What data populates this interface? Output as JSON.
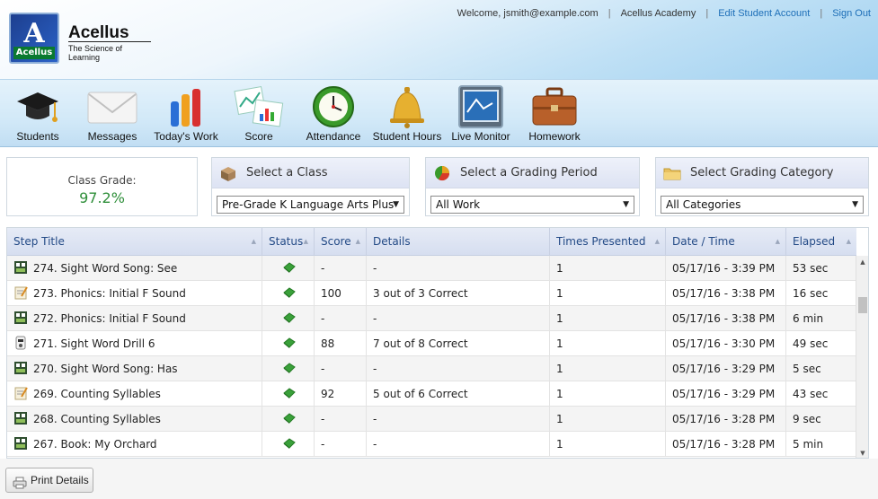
{
  "header": {
    "logo_text": "Acellus",
    "brand": "Acellus",
    "tagline": "The Science of Learning",
    "welcome": "Welcome, jsmith@example.com",
    "academy": "Acellus Academy",
    "edit_account": "Edit Student Account",
    "sign_out": "Sign Out"
  },
  "toolbar": {
    "items": [
      {
        "label": "Students",
        "icon": "graduation-cap-icon"
      },
      {
        "label": "Messages",
        "icon": "envelope-icon"
      },
      {
        "label": "Today's Work",
        "icon": "bar-chart-icon"
      },
      {
        "label": "Score",
        "icon": "score-charts-icon"
      },
      {
        "label": "Attendance",
        "icon": "clock-icon"
      },
      {
        "label": "Student Hours",
        "icon": "bell-icon"
      },
      {
        "label": "Live Monitor",
        "icon": "monitor-icon"
      },
      {
        "label": "Homework",
        "icon": "briefcase-icon"
      }
    ]
  },
  "grade": {
    "label": "Class Grade:",
    "value": "97.2%"
  },
  "class_select": {
    "title": "Select a Class",
    "value": "Pre-Grade K Language Arts Plus"
  },
  "period_select": {
    "title": "Select a Grading Period",
    "value": "All Work"
  },
  "category_select": {
    "title": "Select Grading Category",
    "value": "All Categories"
  },
  "table": {
    "columns": [
      "Step Title",
      "Status",
      "Score",
      "Details",
      "Times Presented",
      "Date / Time",
      "Elapsed"
    ],
    "rows": [
      {
        "icon": "video-icon",
        "title": "274. Sight Word Song: See",
        "score": "-",
        "details": "-",
        "times": "1",
        "date": "05/17/16 - 3:39 PM",
        "elapsed": "53 sec"
      },
      {
        "icon": "quiz-icon",
        "title": "273. Phonics: Initial F Sound",
        "score": "100",
        "details": "3 out of 3 Correct",
        "times": "1",
        "date": "05/17/16 - 3:38 PM",
        "elapsed": "16 sec"
      },
      {
        "icon": "video-icon",
        "title": "272. Phonics: Initial F Sound",
        "score": "-",
        "details": "-",
        "times": "1",
        "date": "05/17/16 - 3:38 PM",
        "elapsed": "6 min"
      },
      {
        "icon": "drill-icon",
        "title": "271. Sight Word Drill 6",
        "score": "88",
        "details": "7 out of 8 Correct",
        "times": "1",
        "date": "05/17/16 - 3:30 PM",
        "elapsed": "49 sec"
      },
      {
        "icon": "video-icon",
        "title": "270. Sight Word Song: Has",
        "score": "-",
        "details": "-",
        "times": "1",
        "date": "05/17/16 - 3:29 PM",
        "elapsed": "5 sec"
      },
      {
        "icon": "quiz-icon",
        "title": "269. Counting Syllables",
        "score": "92",
        "details": "5 out of 6 Correct",
        "times": "1",
        "date": "05/17/16 - 3:29 PM",
        "elapsed": "43 sec"
      },
      {
        "icon": "video-icon",
        "title": "268. Counting Syllables",
        "score": "-",
        "details": "-",
        "times": "1",
        "date": "05/17/16 - 3:28 PM",
        "elapsed": "9 sec"
      },
      {
        "icon": "video-icon",
        "title": "267. Book: My Orchard",
        "score": "-",
        "details": "-",
        "times": "1",
        "date": "05/17/16 - 3:28 PM",
        "elapsed": "5 min"
      }
    ]
  },
  "footer": {
    "print_label": "Print Details"
  },
  "colors": {
    "link": "#1e6fb8",
    "grade": "#2f8f3a",
    "header_text": "#234a86"
  }
}
